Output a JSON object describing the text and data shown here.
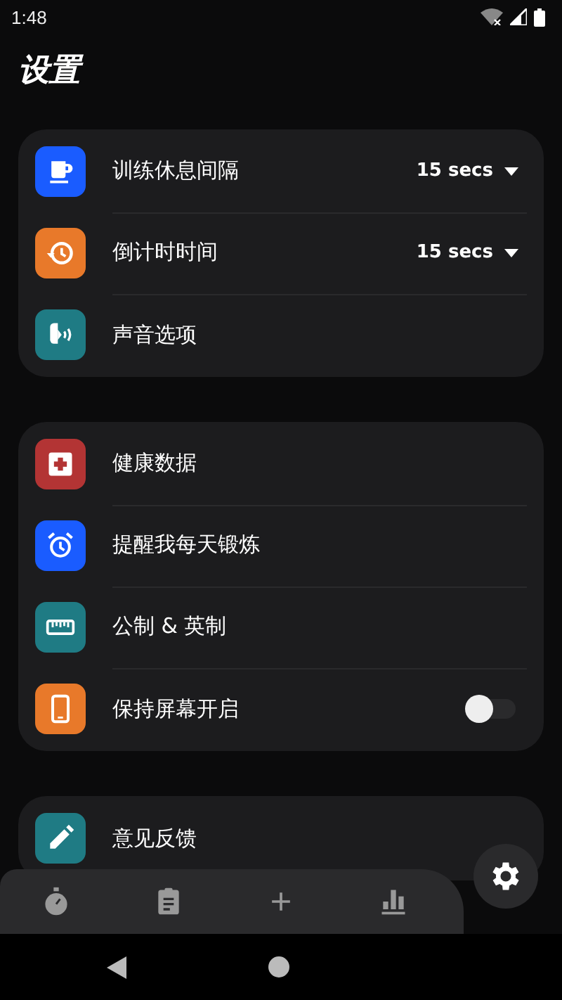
{
  "status_bar": {
    "time": "1:48"
  },
  "title": "设置",
  "sections": [
    {
      "rows": [
        {
          "label": "训练休息间隔",
          "color": "#1a5cff",
          "kind": "dropdown",
          "value": "15 secs"
        },
        {
          "label": "倒计时时间",
          "color": "#e8792a",
          "kind": "dropdown",
          "value": "15 secs"
        },
        {
          "label": "声音选项",
          "color": "#1f7b84",
          "kind": "plain"
        }
      ]
    },
    {
      "rows": [
        {
          "label": "健康数据",
          "color": "#b33434",
          "kind": "plain"
        },
        {
          "label": "提醒我每天锻炼",
          "color": "#1a5cff",
          "kind": "plain"
        },
        {
          "label": "公制 & 英制",
          "color": "#1f7b84",
          "kind": "plain"
        },
        {
          "label": "保持屏幕开启",
          "color": "#e8792a",
          "kind": "toggle",
          "on": false
        }
      ]
    },
    {
      "rows": [
        {
          "label": "意见反馈",
          "color": "#1f7b84",
          "kind": "plain"
        }
      ]
    }
  ]
}
